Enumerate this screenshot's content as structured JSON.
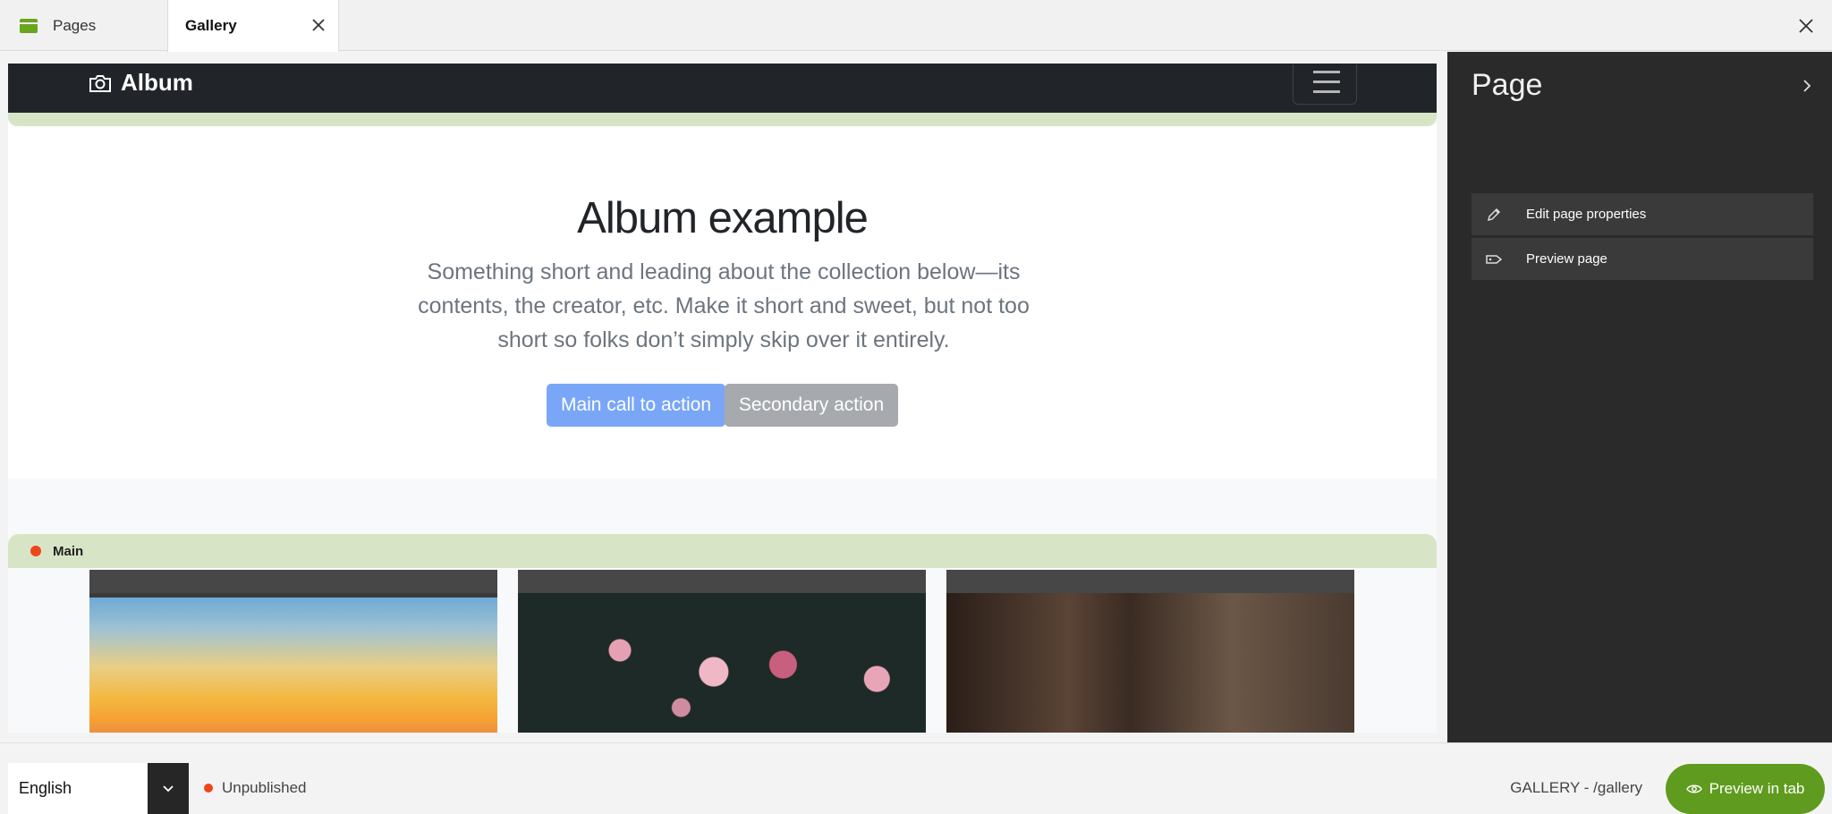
{
  "tabs": [
    {
      "label": "Pages",
      "icon": "pages-icon"
    },
    {
      "label": "Gallery",
      "icon": "close-icon"
    }
  ],
  "canvas": {
    "brand": "Album",
    "hero": {
      "title": "Album example",
      "lead": "Something short and leading about the collection below—its contents, the creator, etc. Make it short and sweet, but not too short so folks don’t simply skip over it entirely.",
      "primary_button": "Main call to action",
      "secondary_button": "Secondary action"
    },
    "main_region_label": "Main"
  },
  "panel": {
    "title": "Page",
    "items": [
      {
        "label": "Edit page properties",
        "icon": "pencil-icon"
      },
      {
        "label": "Preview page",
        "icon": "tag-icon"
      }
    ]
  },
  "bottom": {
    "language": "English",
    "status": "Unpublished",
    "path": "GALLERY - /gallery",
    "preview_button": "Preview in tab"
  },
  "colors": {
    "accent_green": "#5f9b1e",
    "status_red": "#f0441c",
    "primary_blue": "#7aa6f8"
  }
}
